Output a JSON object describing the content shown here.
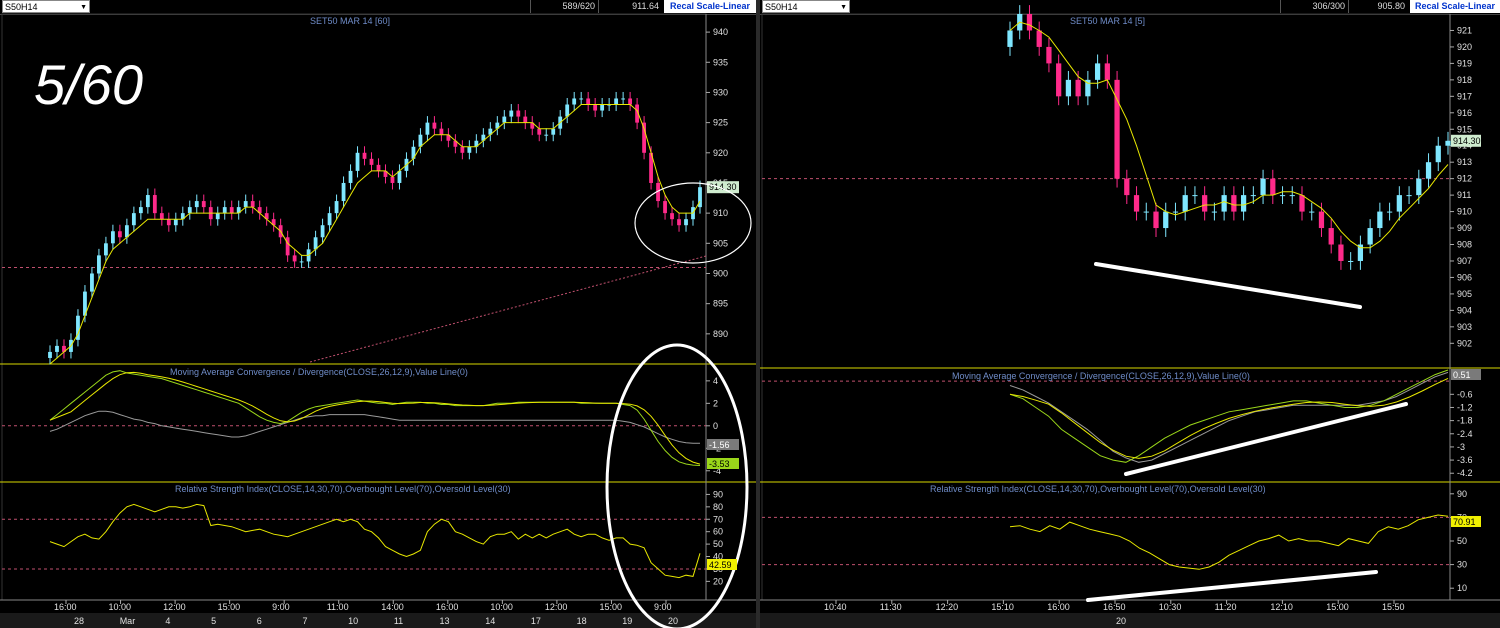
{
  "left": {
    "symbol": "S50H14",
    "toolbar_count": "589/620",
    "toolbar_price": "911.64",
    "recal_label": "Recal Scale-Linear",
    "overlay_label": "5/60",
    "price_title": "SET50 MAR 14  [60]",
    "macd_title": "Moving Average Convergence / Divergence(CLOSE,26,12,9),Value Line(0)",
    "rsi_title": "Relative Strength Index(CLOSE,14,30,70),Overbought Level(70),Oversold Level(30)",
    "last_price_tag": "914.30",
    "macd_tag_1": "-1.56",
    "macd_tag_2": "-3.53",
    "rsi_tag": "42.59"
  },
  "right": {
    "symbol": "S50H14",
    "toolbar_count": "306/300",
    "toolbar_price": "905.80",
    "recal_label": "Recal Scale-Linear",
    "price_title": "SET50 MAR 14  [5]",
    "macd_title": "Moving Average Convergence / Divergence(CLOSE,26,12,9),Value Line(0)",
    "rsi_title": "Relative Strength Index(CLOSE,14,30,70),Overbought Level(70),Oversold Level(30)",
    "last_price_tag": "914.30",
    "macd_tag": "0.51",
    "rsi_tag": "70.91"
  },
  "colors": {
    "up_candle": "#7fe7ff",
    "down_candle": "#ff2a8a",
    "ma_yellow": "#e8e800",
    "ma_green": "#9ad61a",
    "signal_gray": "#9a9a9a",
    "level_line": "#c0506e",
    "axis_text": "#e0e0e0",
    "title_text": "#6f8cc8",
    "annotation_white": "#ffffff"
  },
  "chart_data": [
    {
      "type": "candlestick",
      "title": "SET50 MAR 14  [60]",
      "ylim": [
        885,
        943
      ],
      "yticks": [
        890,
        895,
        900,
        905,
        910,
        915,
        920,
        925,
        930,
        935,
        940
      ],
      "xticks_time": [
        "16:00",
        "10:00",
        "12:00",
        "15:00",
        "9:00",
        "11:00",
        "14:00",
        "16:00",
        "10:00",
        "12:00",
        "15:00",
        "9:00"
      ],
      "xticks_date": [
        "28",
        "Mar",
        "4",
        "5",
        "6",
        "7",
        "10",
        "11",
        "13",
        "14",
        "17",
        "18",
        "19",
        "20"
      ],
      "closes": [
        887,
        888,
        887,
        889,
        893,
        897,
        900,
        903,
        905,
        907,
        906,
        908,
        910,
        911,
        913,
        910,
        909,
        908,
        909,
        910,
        911,
        912,
        911,
        909,
        910,
        911,
        910,
        911,
        912,
        911,
        910,
        909,
        908,
        906,
        903,
        902,
        902,
        904,
        906,
        908,
        910,
        912,
        915,
        917,
        920,
        919,
        918,
        917,
        916,
        915,
        917,
        919,
        921,
        923,
        925,
        924,
        923,
        922,
        921,
        920,
        921,
        922,
        923,
        924,
        925,
        926,
        927,
        926,
        925,
        924,
        923,
        923,
        924,
        926,
        928,
        929,
        929,
        928,
        927,
        928,
        928,
        929,
        929,
        928,
        925,
        920,
        915,
        912,
        910,
        909,
        908,
        909,
        911,
        914.3
      ],
      "ma_fast": [
        885,
        886,
        887,
        888,
        890,
        893,
        896,
        899,
        902,
        904,
        905,
        906,
        907,
        908,
        909,
        909,
        909,
        909,
        909,
        909,
        910,
        910,
        910,
        910,
        910,
        910,
        910,
        910,
        911,
        911,
        910,
        909,
        908,
        907,
        905,
        904,
        903,
        903,
        904,
        905,
        907,
        909,
        911,
        913,
        915,
        916,
        917,
        917,
        917,
        916,
        917,
        918,
        919,
        921,
        922,
        923,
        923,
        923,
        922,
        921,
        921,
        921,
        922,
        923,
        924,
        925,
        925,
        925,
        925,
        925,
        924,
        924,
        924,
        925,
        926,
        927,
        928,
        928,
        928,
        928,
        928,
        928,
        928,
        928,
        927,
        924,
        920,
        916,
        913,
        911,
        910,
        910,
        910,
        912
      ],
      "macd": [
        0.5,
        1,
        1.5,
        2,
        2.5,
        3,
        3.5,
        4,
        4.5,
        4.8,
        4.9,
        4.7,
        4.6,
        4.5,
        4.4,
        4.3,
        4.2,
        4,
        3.8,
        3.6,
        3.4,
        3.2,
        3,
        2.8,
        2.6,
        2.4,
        2.2,
        2,
        1.6,
        1.2,
        0.8,
        0.5,
        0.3,
        0.2,
        0.4,
        0.8,
        1.2,
        1.5,
        1.7,
        1.8,
        1.9,
        2,
        2.1,
        2.2,
        2.3,
        2.2,
        2.1,
        2,
        2,
        1.9,
        2,
        2.1,
        2.1,
        2.1,
        2,
        2,
        1.9,
        1.9,
        1.8,
        1.8,
        1.8,
        1.8,
        1.8,
        1.9,
        2,
        2,
        2,
        2.1,
        2.1,
        2.1,
        2.1,
        2.1,
        2.1,
        2.1,
        2.1,
        2.1,
        2,
        2,
        2,
        2,
        2,
        2,
        1.9,
        1.8,
        1.4,
        0.6,
        -0.4,
        -1.4,
        -2.2,
        -2.8,
        -3.2,
        -3.4,
        -3.5,
        -3.53
      ],
      "macd_signal": [
        -0.5,
        -0.3,
        0,
        0.3,
        0.6,
        0.9,
        1.1,
        1.3,
        1.3,
        1.2,
        1,
        0.8,
        0.6,
        0.5,
        0.3,
        0.2,
        0,
        -0.1,
        -0.2,
        -0.3,
        -0.4,
        -0.5,
        -0.6,
        -0.7,
        -0.8,
        -0.9,
        -1,
        -1,
        -0.9,
        -0.7,
        -0.5,
        -0.3,
        -0.1,
        0.1,
        0.3,
        0.5,
        0.7,
        0.8,
        0.9,
        0.9,
        1,
        1,
        1,
        1,
        1,
        1,
        0.9,
        0.8,
        0.7,
        0.6,
        0.5,
        0.5,
        0.5,
        0.5,
        0.5,
        0.5,
        0.5,
        0.5,
        0.5,
        0.5,
        0.5,
        0.5,
        0.5,
        0.5,
        0.5,
        0.5,
        0.5,
        0.5,
        0.5,
        0.5,
        0.5,
        0.5,
        0.5,
        0.5,
        0.5,
        0.5,
        0.5,
        0.5,
        0.5,
        0.5,
        0.5,
        0.5,
        0.4,
        0.3,
        0.1,
        -0.1,
        -0.4,
        -0.7,
        -1,
        -1.2,
        -1.4,
        -1.5,
        -1.55,
        -1.56
      ],
      "macd_ylim": [
        -5,
        5.5
      ],
      "macd_yticks": [
        -4,
        -2,
        0,
        2,
        4
      ],
      "rsi": [
        52,
        50,
        48,
        52,
        56,
        58,
        55,
        54,
        60,
        68,
        75,
        80,
        82,
        80,
        78,
        76,
        78,
        80,
        80,
        79,
        80,
        82,
        81,
        65,
        66,
        65,
        64,
        62,
        60,
        61,
        62,
        60,
        58,
        57,
        56,
        58,
        60,
        62,
        64,
        66,
        68,
        70,
        68,
        70,
        68,
        62,
        60,
        55,
        48,
        45,
        42,
        40,
        42,
        45,
        60,
        66,
        70,
        68,
        60,
        58,
        55,
        52,
        50,
        56,
        58,
        58,
        60,
        54,
        58,
        55,
        58,
        55,
        58,
        60,
        62,
        58,
        56,
        58,
        58,
        55,
        53,
        55,
        55,
        50,
        49,
        47,
        35,
        30,
        25,
        24,
        23,
        25,
        24,
        42.59
      ],
      "rsi_ylim": [
        5,
        100
      ],
      "rsi_yticks": [
        20,
        30,
        40,
        50,
        60,
        70,
        80,
        90
      ]
    },
    {
      "type": "candlestick",
      "title": "SET50 MAR 14  [5]",
      "ylim": [
        900.5,
        922
      ],
      "yticks": [
        902,
        903,
        904,
        905,
        906,
        907,
        908,
        909,
        910,
        911,
        912,
        913,
        914,
        915,
        916,
        917,
        918,
        919,
        920,
        921
      ],
      "xticks_time": [
        "10:40",
        "11:30",
        "12:20",
        "15:10",
        "16:00",
        "16:50",
        "10:30",
        "11:20",
        "12:10",
        "15:00",
        "15:50"
      ],
      "xticks_date": [
        "20"
      ],
      "closes": [
        921,
        922,
        921,
        920,
        919,
        917,
        918,
        917,
        918,
        919,
        918,
        912,
        911,
        910,
        910,
        909,
        910,
        910,
        911,
        911,
        910,
        910,
        911,
        910,
        911,
        911,
        912,
        911,
        911,
        911,
        910,
        910,
        909,
        908,
        907,
        907,
        908,
        909,
        910,
        910,
        911,
        911,
        912,
        913,
        914,
        914.3
      ],
      "macd": [
        -0.6,
        -0.8,
        -1.2,
        -1.6,
        -2.2,
        -2.6,
        -3.0,
        -3.4,
        -3.6,
        -3.7,
        -3.4,
        -3.0,
        -2.6,
        -2.3,
        -2.0,
        -1.8,
        -1.6,
        -1.4,
        -1.3,
        -1.2,
        -1.1,
        -1.0,
        -0.9,
        -0.9,
        -1.0,
        -1.1,
        -1.2,
        -1.2,
        -1.1,
        -0.9,
        -0.6,
        -0.3,
        0,
        0.3,
        0.51
      ],
      "macd_signal": [
        -0.2,
        -0.4,
        -0.7,
        -1.0,
        -1.4,
        -1.8,
        -2.2,
        -2.7,
        -3.2,
        -3.5,
        -3.7,
        -3.6,
        -3.3,
        -3.0,
        -2.7,
        -2.4,
        -2.1,
        -1.8,
        -1.6,
        -1.4,
        -1.3,
        -1.2,
        -1.1,
        -1.1,
        -1.1,
        -1.1,
        -1.1,
        -1.1,
        -1.0,
        -0.9,
        -0.7,
        -0.4,
        -0.1,
        0.2,
        0.4
      ],
      "macd_ylim": [
        -4.6,
        0.6
      ],
      "macd_yticks": [
        -4.2,
        -3.6,
        -3.0,
        -2.4,
        -1.8,
        -1.2,
        -0.6
      ],
      "rsi": [
        62,
        63,
        60,
        58,
        63,
        60,
        66,
        63,
        60,
        58,
        56,
        54,
        50,
        44,
        40,
        35,
        30,
        28,
        27,
        26,
        28,
        32,
        38,
        42,
        46,
        50,
        52,
        55,
        50,
        52,
        50,
        50,
        48,
        46,
        52,
        50,
        48,
        58,
        62,
        60,
        63,
        68,
        70,
        72,
        70.91
      ],
      "rsi_ylim": [
        0,
        100
      ],
      "rsi_yticks": [
        10,
        30,
        50,
        70,
        90
      ]
    }
  ]
}
